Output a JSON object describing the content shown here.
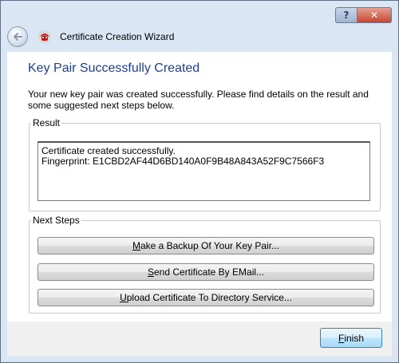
{
  "window": {
    "title": "Certificate Creation Wizard",
    "help_label": "?",
    "close_label": "✕"
  },
  "page": {
    "heading": "Key Pair Successfully Created",
    "intro": "Your new key pair was created successfully. Please find details on the result and some suggested next steps below."
  },
  "result": {
    "group_label": "Result",
    "line1": "Certificate created successfully.",
    "line2": "Fingerprint: E1CBD2AF44D6BD140A0F9B48A843A52F9C7566F3"
  },
  "next_steps": {
    "group_label": "Next Steps",
    "backup": {
      "mnemonic": "M",
      "rest": "ake a Backup Of Your Key Pair..."
    },
    "email": {
      "mnemonic": "S",
      "rest": "end Certificate By EMail..."
    },
    "upload": {
      "mnemonic": "U",
      "rest": "pload Certificate To Directory Service..."
    }
  },
  "footer": {
    "finish": {
      "mnemonic": "F",
      "rest": "inish"
    }
  },
  "colors": {
    "heading": "#1f3f8f",
    "frame": "#dbe6f4",
    "close": "#c8452f"
  },
  "icons": {
    "back": "back-arrow-icon",
    "app": "kleopatra-app-icon"
  }
}
